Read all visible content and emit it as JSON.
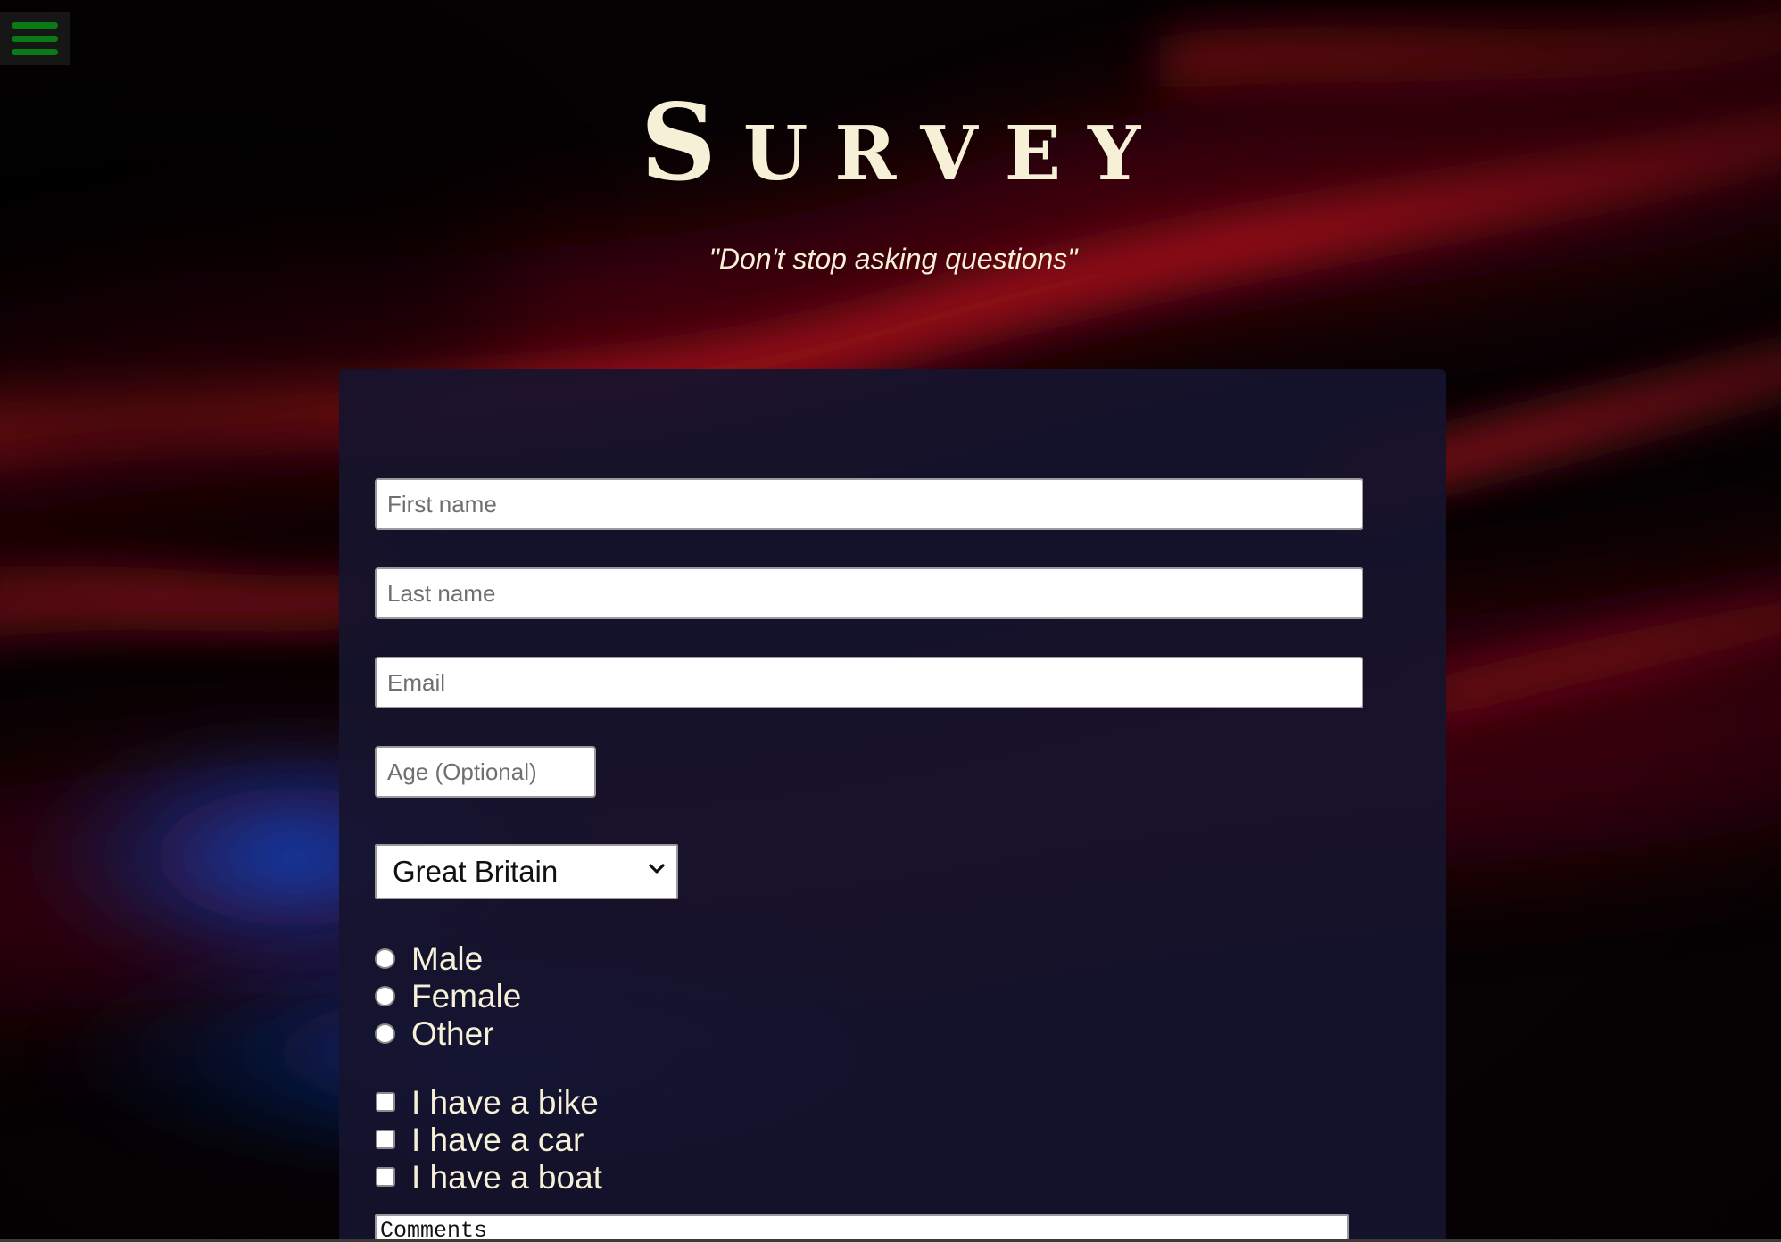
{
  "nav": {
    "menu_icon": "hamburger-menu-icon",
    "menu_color": "#0a7a14"
  },
  "header": {
    "title": "Survey",
    "tagline": "\"Don't stop asking questions\""
  },
  "form": {
    "first_name": {
      "value": "",
      "placeholder": "First name"
    },
    "last_name": {
      "value": "",
      "placeholder": "Last name"
    },
    "email": {
      "value": "",
      "placeholder": "Email"
    },
    "age": {
      "value": "",
      "placeholder": "Age (Optional)"
    },
    "country": {
      "selected": "Great Britain",
      "icon": "chevron-down-icon"
    },
    "gender": [
      {
        "label": "Male",
        "checked": false
      },
      {
        "label": "Female",
        "checked": false
      },
      {
        "label": "Other",
        "checked": false
      }
    ],
    "vehicles": [
      {
        "label": "I have a bike",
        "checked": false
      },
      {
        "label": "I have a car",
        "checked": false
      },
      {
        "label": "I have a boat",
        "checked": false
      }
    ],
    "comments": {
      "value": "",
      "placeholder": "Comments"
    }
  },
  "colors": {
    "text_cream": "#f5f0d6",
    "panel": "#16142e",
    "background_red": "#6a0a10",
    "background_blue": "#0d2f8a"
  }
}
